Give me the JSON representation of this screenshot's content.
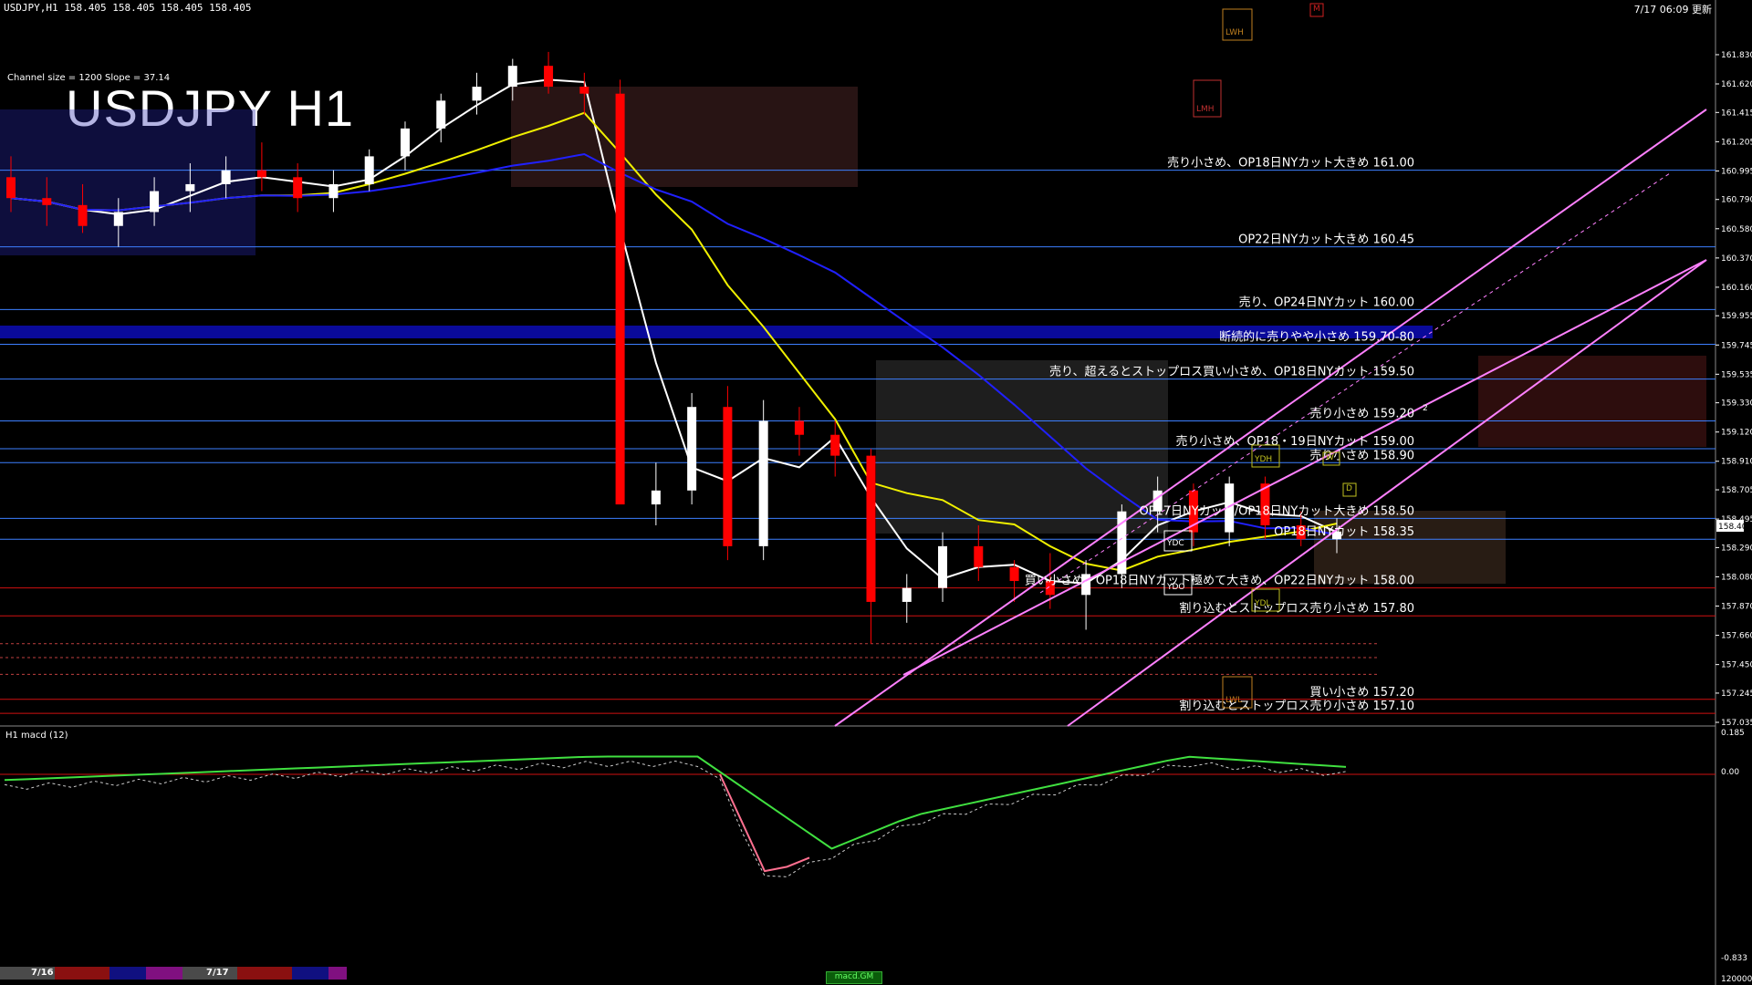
{
  "header": {
    "symbol_line": "USDJPY,H1  158.405 158.405 158.405 158.405",
    "timestamp": "7/17 06:09 更新"
  },
  "title": "USDJPY H1",
  "channel_info": "Channel size = 1200 Slope = 37.14",
  "macd_label": "H1  macd (12)",
  "bottom": {
    "date_1": "7/16",
    "date_2": "7/17",
    "tab": "macd.GM"
  },
  "colors": {
    "background": "#000000",
    "candle_up": "#ffffff",
    "candle_down": "#ff0000",
    "level_line": "#3c7fff",
    "level_line_red": "#d01010",
    "band": "#0a0a9a",
    "ma_white": "#ffffff",
    "ma_yellow": "#f0f000",
    "ma_blue": "#2020ff",
    "channel": "#ff80ff",
    "macd_up": "#40e040",
    "macd_down": "#ff7090"
  },
  "chart_data": {
    "type": "candlestick",
    "yaxis": {
      "min": 157.035,
      "max": 162.0,
      "ticks": [
        "161.830",
        "161.620",
        "161.415",
        "161.205",
        "160.995",
        "160.790",
        "160.580",
        "160.370",
        "160.160",
        "159.955",
        "159.745",
        "159.535",
        "159.330",
        "159.120",
        "158.910",
        "158.705",
        "158.495",
        "158.290",
        "158.080",
        "157.870",
        "157.660",
        "157.450",
        "157.245",
        "157.035"
      ],
      "current_price": "158.405"
    },
    "macd_axis": {
      "ticks": [
        "0.185",
        "0.00",
        "-0.833"
      ],
      "bottom_value": "120000"
    },
    "annotations": [
      {
        "text": "売り小さめ、OP18日NYカット大きめ 161.00",
        "price": 161.0
      },
      {
        "text": "OP22日NYカット大きめ 160.45",
        "price": 160.45
      },
      {
        "text": "売り、OP24日NYカット 160.00",
        "price": 160.0
      },
      {
        "text": "断続的に売りやや小さめ 159.70-80",
        "price": 159.75
      },
      {
        "text": "売り、超えるとストップロス買い小さめ、OP18日NYカット 159.50",
        "price": 159.5
      },
      {
        "text": "売り小さめ 159.20",
        "price": 159.2
      },
      {
        "text": "売り小さめ、OP18・19日NYカット 159.00",
        "price": 159.0
      },
      {
        "text": "売り小さめ 158.90",
        "price": 158.9
      },
      {
        "text": "OP17日NYカット/OP18日NYカット大きめ 158.50",
        "price": 158.5
      },
      {
        "text": "OP18日NYカット 158.35",
        "price": 158.35
      },
      {
        "text": "買い小さめ、OP18日NYカット極めて大きめ、OP22日NYカット 158.00",
        "price": 158.0
      },
      {
        "text": "割り込むとストップロス売り小さめ 157.80",
        "price": 157.8
      },
      {
        "text": "買い小さめ 157.20",
        "price": 157.2
      },
      {
        "text": "割り込むとストップロス売り小さめ 157.10",
        "price": 157.1
      }
    ],
    "box_labels": [
      "LWH",
      "LMH",
      "YDH",
      "YDC",
      "YDO",
      "YDL",
      "LWL",
      "W",
      "D",
      "M",
      "2"
    ],
    "candles_ohlc": [
      [
        160.95,
        161.1,
        160.7,
        160.8
      ],
      [
        160.8,
        160.95,
        160.6,
        160.75
      ],
      [
        160.75,
        160.9,
        160.55,
        160.6
      ],
      [
        160.6,
        160.8,
        160.45,
        160.7
      ],
      [
        160.7,
        160.95,
        160.6,
        160.85
      ],
      [
        160.85,
        161.05,
        160.7,
        160.9
      ],
      [
        160.9,
        161.1,
        160.8,
        161.0
      ],
      [
        161.0,
        161.2,
        160.85,
        160.95
      ],
      [
        160.95,
        161.05,
        160.7,
        160.8
      ],
      [
        160.8,
        161.0,
        160.7,
        160.9
      ],
      [
        160.9,
        161.15,
        160.85,
        161.1
      ],
      [
        161.1,
        161.35,
        161.0,
        161.3
      ],
      [
        161.3,
        161.55,
        161.2,
        161.5
      ],
      [
        161.5,
        161.7,
        161.4,
        161.6
      ],
      [
        161.6,
        161.8,
        161.5,
        161.75
      ],
      [
        161.75,
        161.85,
        161.55,
        161.6
      ],
      [
        161.6,
        161.7,
        161.4,
        161.55
      ],
      [
        161.55,
        161.65,
        159.8,
        158.6
      ],
      [
        158.6,
        158.9,
        158.45,
        158.7
      ],
      [
        158.7,
        159.4,
        158.6,
        159.3
      ],
      [
        159.3,
        159.45,
        158.2,
        158.3
      ],
      [
        158.3,
        159.35,
        158.2,
        159.2
      ],
      [
        159.2,
        159.3,
        158.95,
        159.1
      ],
      [
        159.1,
        159.2,
        158.8,
        158.95
      ],
      [
        158.95,
        159.0,
        157.6,
        157.9
      ],
      [
        157.9,
        158.1,
        157.75,
        158.0
      ],
      [
        158.0,
        158.4,
        157.9,
        158.3
      ],
      [
        158.3,
        158.45,
        158.05,
        158.15
      ],
      [
        158.15,
        158.2,
        157.9,
        158.05
      ],
      [
        158.05,
        158.25,
        157.85,
        157.95
      ],
      [
        157.95,
        158.2,
        157.7,
        158.1
      ],
      [
        158.1,
        158.6,
        158.0,
        158.55
      ],
      [
        158.55,
        158.8,
        158.4,
        158.7
      ],
      [
        158.7,
        158.75,
        158.3,
        158.4
      ],
      [
        158.4,
        158.8,
        158.3,
        158.75
      ],
      [
        158.75,
        158.8,
        158.35,
        158.45
      ],
      [
        158.45,
        158.55,
        158.3,
        158.35
      ],
      [
        158.35,
        158.5,
        158.25,
        158.405
      ]
    ]
  }
}
